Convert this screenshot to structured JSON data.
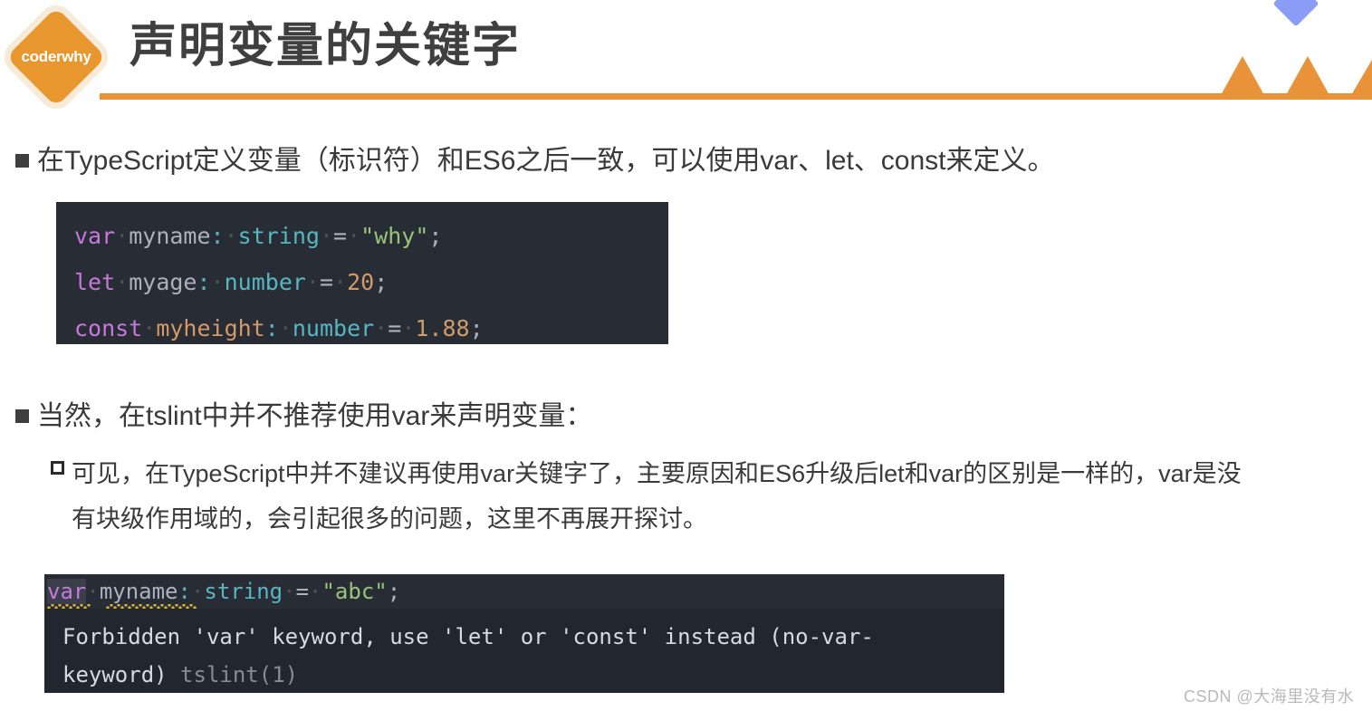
{
  "slide": {
    "title": "声明变量的关键字",
    "logo_text": "coderwhy",
    "accent_color": "#e8923a",
    "logo_color": "#e8972e",
    "diamond_color": "#8a9cf5"
  },
  "bullets": {
    "bullet1": "在TypeScript定义变量（标识符）和ES6之后一致，可以使用var、let、const来定义。",
    "bullet2": "当然，在tslint中并不推荐使用var来声明变量：",
    "sub1_line1": "可见，在TypeScript中并不建议再使用var关键字了，主要原因和ES6升级后let和var的区别是一样的，var是没",
    "sub1_line2": "有块级作用域的，会引起很多的问题，这里不再展开探讨。"
  },
  "code_block_1": {
    "lines": [
      {
        "keyword": "var",
        "name": "myname",
        "colon": ":",
        "type": "string",
        "equals": "=",
        "value": "\"why\"",
        "semicolon": ";",
        "value_kind": "string",
        "name_kind": "let"
      },
      {
        "keyword": "let",
        "name": "myage",
        "colon": ":",
        "type": "number",
        "equals": "=",
        "value": "20",
        "semicolon": ";",
        "value_kind": "number",
        "name_kind": "let"
      },
      {
        "keyword": "const",
        "name": "myheight",
        "colon": ":",
        "type": "number",
        "equals": "=",
        "value": "1.88",
        "semicolon": ";",
        "value_kind": "number",
        "name_kind": "const"
      }
    ]
  },
  "code_block_2": {
    "editor_line": {
      "keyword": "var",
      "name": "myname",
      "colon": ":",
      "type": "string",
      "equals": "=",
      "value": "\"abc\"",
      "semicolon": ";"
    },
    "tooltip_line1": "Forbidden 'var' keyword, use 'let' or 'const' instead (no-var-",
    "tooltip_line2": "keyword) ",
    "tooltip_source": "tslint(1)"
  },
  "watermark": "CSDN @大海里没有水"
}
